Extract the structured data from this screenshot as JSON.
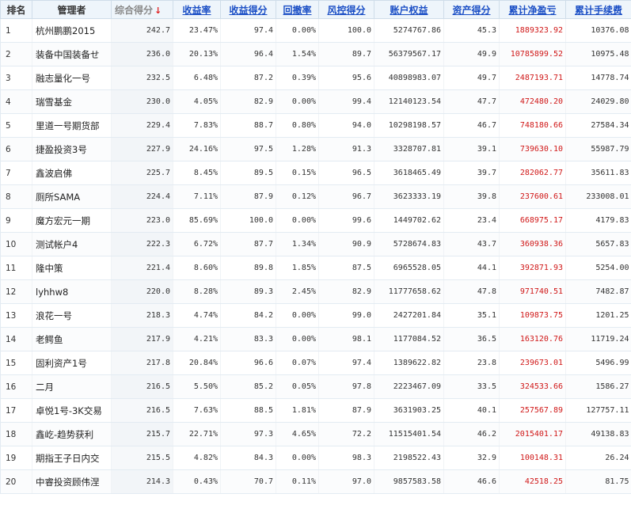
{
  "header": {
    "rank": "排名",
    "manager": "管理者",
    "overall_score": "综合得分",
    "sort_arrow": "↓",
    "return_rate": "收益率",
    "return_score": "收益得分",
    "drawdown": "回撤率",
    "risk_score": "风控得分",
    "equity": "账户权益",
    "asset_score": "资产得分",
    "net_profit": "累计净盈亏",
    "fees": "累计手续费"
  },
  "colors": {
    "header_bg": "#eef5fb",
    "link_blue": "#1a4ec5",
    "profit_red": "#d01818",
    "sort_arrow_red": "#e02020"
  },
  "rows": [
    {
      "rank": "1",
      "manager": "杭州鹏鹏2015",
      "score": "242.7",
      "return_rate": "23.47%",
      "return_score": "97.4",
      "drawdown": "0.00%",
      "risk_score": "100.0",
      "equity": "5274767.86",
      "asset_score": "45.3",
      "net_profit": "1889323.92",
      "fees": "10376.08"
    },
    {
      "rank": "2",
      "manager": "装备中国装备せ",
      "score": "236.0",
      "return_rate": "20.13%",
      "return_score": "96.4",
      "drawdown": "1.54%",
      "risk_score": "89.7",
      "equity": "56379567.17",
      "asset_score": "49.9",
      "net_profit": "10785899.52",
      "fees": "10975.48"
    },
    {
      "rank": "3",
      "manager": "融志量化一号",
      "score": "232.5",
      "return_rate": "6.48%",
      "return_score": "87.2",
      "drawdown": "0.39%",
      "risk_score": "95.6",
      "equity": "40898983.07",
      "asset_score": "49.7",
      "net_profit": "2487193.71",
      "fees": "14778.74"
    },
    {
      "rank": "4",
      "manager": "瑞雪基金",
      "score": "230.0",
      "return_rate": "4.05%",
      "return_score": "82.9",
      "drawdown": "0.00%",
      "risk_score": "99.4",
      "equity": "12140123.54",
      "asset_score": "47.7",
      "net_profit": "472480.20",
      "fees": "24029.80"
    },
    {
      "rank": "5",
      "manager": "里道一号期货部",
      "score": "229.4",
      "return_rate": "7.83%",
      "return_score": "88.7",
      "drawdown": "0.80%",
      "risk_score": "94.0",
      "equity": "10298198.57",
      "asset_score": "46.7",
      "net_profit": "748180.66",
      "fees": "27584.34"
    },
    {
      "rank": "6",
      "manager": "捷盈投资3号",
      "score": "227.9",
      "return_rate": "24.16%",
      "return_score": "97.5",
      "drawdown": "1.28%",
      "risk_score": "91.3",
      "equity": "3328707.81",
      "asset_score": "39.1",
      "net_profit": "739630.10",
      "fees": "55987.79"
    },
    {
      "rank": "7",
      "manager": "鑫波启佛",
      "score": "225.7",
      "return_rate": "8.45%",
      "return_score": "89.5",
      "drawdown": "0.15%",
      "risk_score": "96.5",
      "equity": "3618465.49",
      "asset_score": "39.7",
      "net_profit": "282062.77",
      "fees": "35611.83"
    },
    {
      "rank": "8",
      "manager": "厕所SAMA",
      "score": "224.4",
      "return_rate": "7.11%",
      "return_score": "87.9",
      "drawdown": "0.12%",
      "risk_score": "96.7",
      "equity": "3623333.19",
      "asset_score": "39.8",
      "net_profit": "237600.61",
      "fees": "233008.01"
    },
    {
      "rank": "9",
      "manager": "魔方宏元一期",
      "score": "223.0",
      "return_rate": "85.69%",
      "return_score": "100.0",
      "drawdown": "0.00%",
      "risk_score": "99.6",
      "equity": "1449702.62",
      "asset_score": "23.4",
      "net_profit": "668975.17",
      "fees": "4179.83"
    },
    {
      "rank": "10",
      "manager": "测试帐户4",
      "score": "222.3",
      "return_rate": "6.72%",
      "return_score": "87.7",
      "drawdown": "1.34%",
      "risk_score": "90.9",
      "equity": "5728674.83",
      "asset_score": "43.7",
      "net_profit": "360938.36",
      "fees": "5657.83"
    },
    {
      "rank": "11",
      "manager": "隆中策",
      "score": "221.4",
      "return_rate": "8.60%",
      "return_score": "89.8",
      "drawdown": "1.85%",
      "risk_score": "87.5",
      "equity": "6965528.05",
      "asset_score": "44.1",
      "net_profit": "392871.93",
      "fees": "5254.00"
    },
    {
      "rank": "12",
      "manager": "lyhhw8",
      "score": "220.0",
      "return_rate": "8.28%",
      "return_score": "89.3",
      "drawdown": "2.45%",
      "risk_score": "82.9",
      "equity": "11777658.62",
      "asset_score": "47.8",
      "net_profit": "971740.51",
      "fees": "7482.87"
    },
    {
      "rank": "13",
      "manager": "浪花一号",
      "score": "218.3",
      "return_rate": "4.74%",
      "return_score": "84.2",
      "drawdown": "0.00%",
      "risk_score": "99.0",
      "equity": "2427201.84",
      "asset_score": "35.1",
      "net_profit": "109873.75",
      "fees": "1201.25"
    },
    {
      "rank": "14",
      "manager": "老鳄鱼",
      "score": "217.9",
      "return_rate": "4.21%",
      "return_score": "83.3",
      "drawdown": "0.00%",
      "risk_score": "98.1",
      "equity": "1177084.52",
      "asset_score": "36.5",
      "net_profit": "163120.76",
      "fees": "11719.24"
    },
    {
      "rank": "15",
      "manager": "固利资产1号",
      "score": "217.8",
      "return_rate": "20.84%",
      "return_score": "96.6",
      "drawdown": "0.07%",
      "risk_score": "97.4",
      "equity": "1389622.82",
      "asset_score": "23.8",
      "net_profit": "239673.01",
      "fees": "5496.99"
    },
    {
      "rank": "16",
      "manager": "二月",
      "score": "216.5",
      "return_rate": "5.50%",
      "return_score": "85.2",
      "drawdown": "0.05%",
      "risk_score": "97.8",
      "equity": "2223467.09",
      "asset_score": "33.5",
      "net_profit": "324533.66",
      "fees": "1586.27"
    },
    {
      "rank": "17",
      "manager": "卓悦1号-3K交易",
      "score": "216.5",
      "return_rate": "7.63%",
      "return_score": "88.5",
      "drawdown": "1.81%",
      "risk_score": "87.9",
      "equity": "3631903.25",
      "asset_score": "40.1",
      "net_profit": "257567.89",
      "fees": "127757.11"
    },
    {
      "rank": "18",
      "manager": "鑫屹-趋势获利",
      "score": "215.7",
      "return_rate": "22.71%",
      "return_score": "97.3",
      "drawdown": "4.65%",
      "risk_score": "72.2",
      "equity": "11515401.54",
      "asset_score": "46.2",
      "net_profit": "2015401.17",
      "fees": "49138.83"
    },
    {
      "rank": "19",
      "manager": "期指王子日内交",
      "score": "215.5",
      "return_rate": "4.82%",
      "return_score": "84.3",
      "drawdown": "0.00%",
      "risk_score": "98.3",
      "equity": "2198522.43",
      "asset_score": "32.9",
      "net_profit": "100148.31",
      "fees": "26.24"
    },
    {
      "rank": "20",
      "manager": "中睿投资顾伟涅",
      "score": "214.3",
      "return_rate": "0.43%",
      "return_score": "70.7",
      "drawdown": "0.11%",
      "risk_score": "97.0",
      "equity": "9857583.58",
      "asset_score": "46.6",
      "net_profit": "42518.25",
      "fees": "81.75"
    }
  ]
}
